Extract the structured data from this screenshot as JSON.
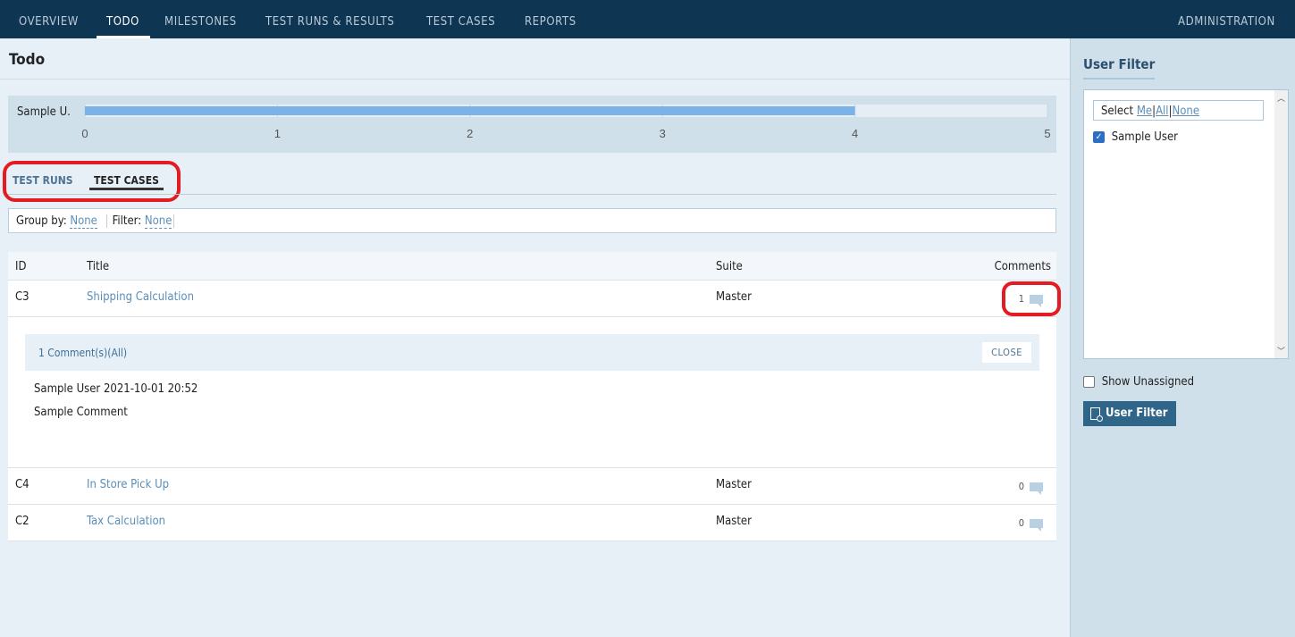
{
  "nav": {
    "items": [
      "OVERVIEW",
      "TODO",
      "MILESTONES",
      "TEST RUNS & RESULTS",
      "TEST CASES",
      "REPORTS"
    ],
    "active": "TODO",
    "admin": "ADMINISTRATION"
  },
  "page": {
    "title": "Todo"
  },
  "chart": {
    "type": "bar",
    "orientation": "horizontal",
    "categories": [
      "Sample U."
    ],
    "values": [
      4
    ],
    "xlim": [
      0,
      5
    ],
    "ticks": [
      "0",
      "1",
      "2",
      "3",
      "4",
      "5"
    ],
    "bar_color": "#7bb3e8"
  },
  "tabs": {
    "runs": "TEST RUNS",
    "cases": "TEST CASES",
    "active": "TEST CASES"
  },
  "filterbar": {
    "group_label": "Group by:",
    "group_value": "None",
    "filter_label": "Filter:",
    "filter_value": "None"
  },
  "table": {
    "headers": {
      "id": "ID",
      "title": "Title",
      "suite": "Suite",
      "comments": "Comments"
    },
    "rows": [
      {
        "id": "C3",
        "title": "Shipping Calculation",
        "suite": "Master",
        "comments": "1"
      },
      {
        "id": "C4",
        "title": "In Store Pick Up",
        "suite": "Master",
        "comments": "0"
      },
      {
        "id": "C2",
        "title": "Tax Calculation",
        "suite": "Master",
        "comments": "0"
      }
    ]
  },
  "comments_panel": {
    "header": "1 Comment(s)(All)",
    "close": "CLOSE",
    "author_line": "Sample User 2021-10-01 20:52",
    "text": "Sample Comment"
  },
  "sidebar": {
    "title": "User Filter",
    "select_label": "Select",
    "me": "Me",
    "all": "All",
    "none": "None",
    "user": "Sample User",
    "user_checked": true,
    "show_unassigned": "Show Unassigned",
    "show_unassigned_checked": false,
    "button": "User Filter"
  },
  "colors": {
    "nav": "#0e3552",
    "accent": "#2f6589",
    "highlight": "#e31b23"
  }
}
